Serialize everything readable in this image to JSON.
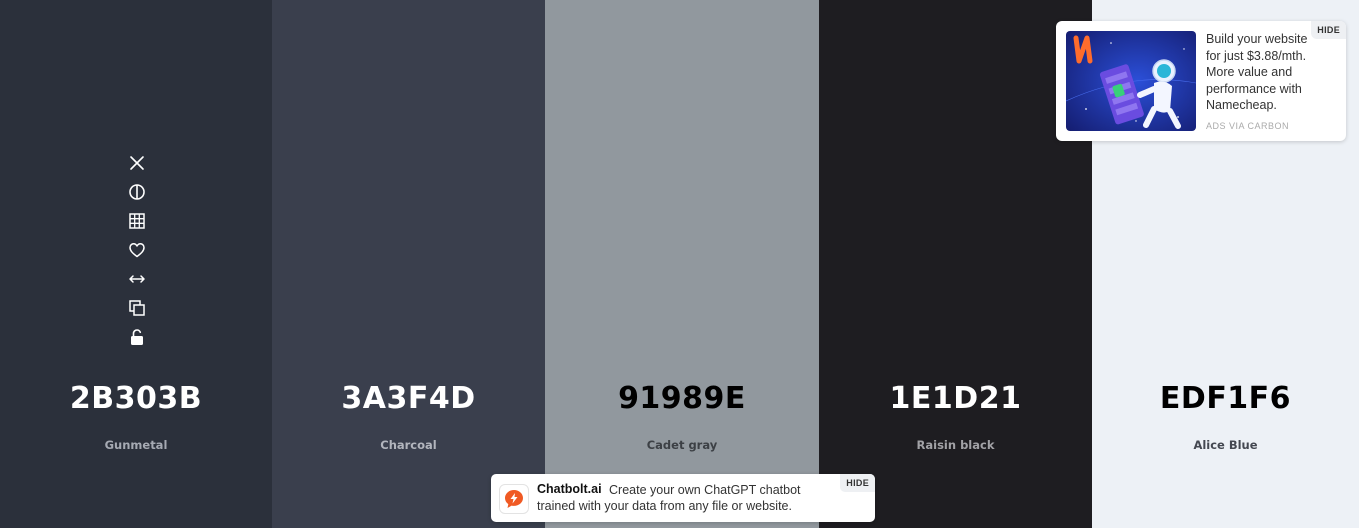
{
  "palette": {
    "swatches": [
      {
        "hex": "2B303B",
        "name": "Gunmetal",
        "bg": "#2B303B",
        "text_color": "#FFFFFF",
        "name_color": "#A6AAB3"
      },
      {
        "hex": "3A3F4D",
        "name": "Charcoal",
        "bg": "#3A3F4D",
        "text_color": "#FFFFFF",
        "name_color": "#B2B5BD"
      },
      {
        "hex": "91989E",
        "name": "Cadet gray",
        "bg": "#91989E",
        "text_color": "#000000",
        "name_color": "#3C4045"
      },
      {
        "hex": "1E1D21",
        "name": "Raisin black",
        "bg": "#1E1D21",
        "text_color": "#FFFFFF",
        "name_color": "#A2A2A6"
      },
      {
        "hex": "EDF1F6",
        "name": "Alice Blue",
        "bg": "#EDF1F6",
        "text_color": "#000000",
        "name_color": "#444851"
      }
    ]
  },
  "toolbar": {
    "icons": [
      "close-icon",
      "contrast-icon",
      "grid-icon",
      "heart-icon",
      "drag-arrows-icon",
      "copy-icon",
      "unlock-icon"
    ]
  },
  "carbon_ad": {
    "text": "Build your website for just $3.88/mth. More value and performance with Namecheap.",
    "via_label": "ADS VIA CARBON",
    "hide_label": "HIDE"
  },
  "chatbolt_ad": {
    "brand": "Chatbolt.ai",
    "message": "Create your own ChatGPT chatbot trained with your data from any file or website.",
    "hide_label": "HIDE",
    "accent_color": "#F05A24"
  }
}
